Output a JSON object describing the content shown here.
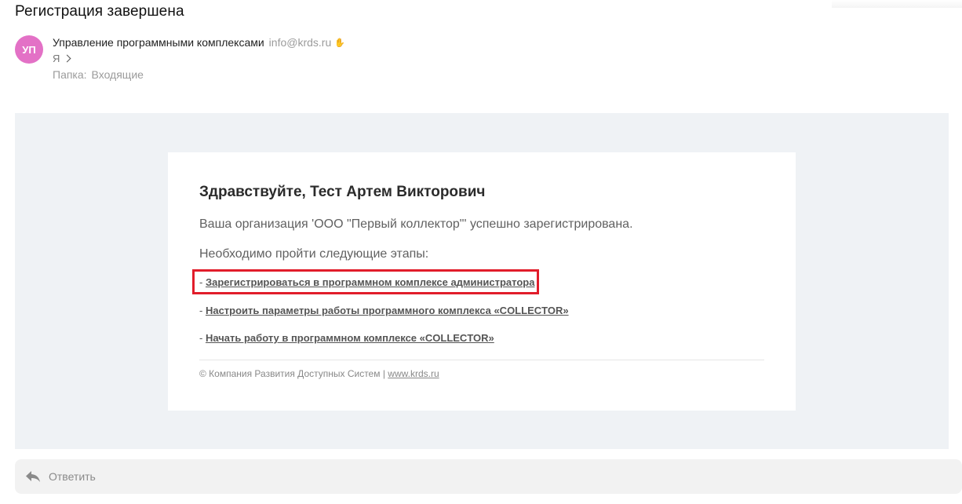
{
  "message": {
    "subject": "Регистрация завершена",
    "avatar_initials": "УП",
    "sender_name": "Управление программными комплексами",
    "sender_email": "info@krds.ru",
    "recipient": "Я",
    "folder_label": "Папка:",
    "folder_value": "Входящие"
  },
  "body": {
    "greeting": "Здравствуйте, Тест Артем Викторович",
    "org_text": "Ваша организация 'ООО \"Первый коллектор\"' успешно зарегистрирована.",
    "steps_intro": "Необходимо пройти следующие этапы:",
    "steps": [
      {
        "prefix": "- ",
        "link": "Зарегистрироваться в программном комплексе администратора"
      },
      {
        "prefix": "- ",
        "link": "Настроить параметры работы программного комплекса «COLLECTOR»"
      },
      {
        "prefix": "- ",
        "link": "Начать работу в программном комплексе «COLLECTOR»"
      }
    ],
    "footer_text": "© Компания Развития Доступных Систем | ",
    "footer_link": "www.krds.ru"
  },
  "actions": {
    "reply_label": "Ответить"
  },
  "colors": {
    "avatar": "#e371c6",
    "highlight": "#e11d2b",
    "mail_background": "#eff2f5"
  },
  "icons": [
    "verified-icon",
    "chevron-right-icon",
    "reply-icon"
  ]
}
